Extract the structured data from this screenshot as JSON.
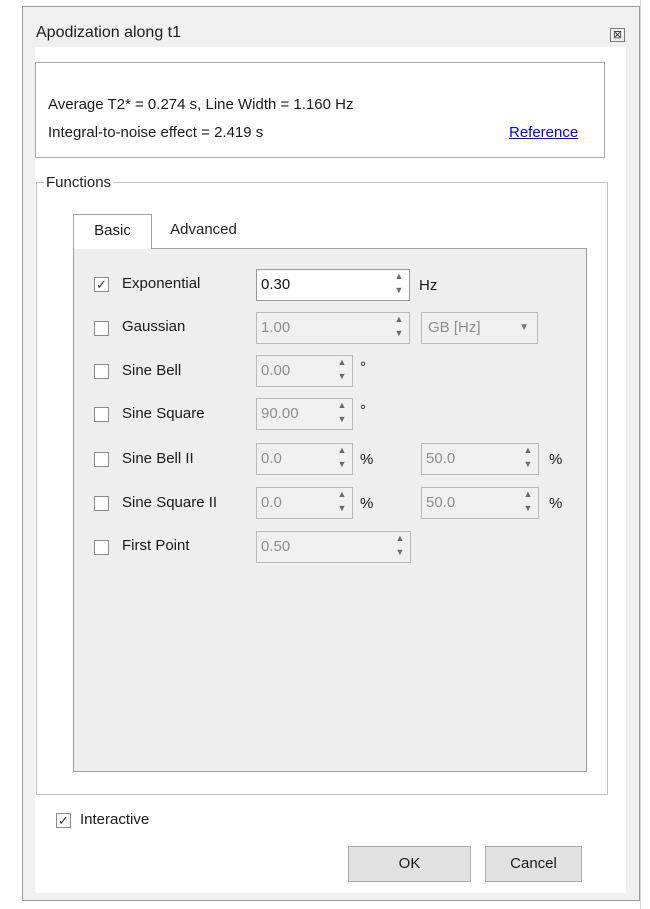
{
  "dialog": {
    "title": "Apodization along t1",
    "close_glyph": "⊠"
  },
  "info": {
    "line1": "Average T2* = 0.274 s, Line Width = 1.160 Hz",
    "line2": "Integral-to-noise effect = 2.419 s",
    "reference_link": "Reference"
  },
  "functions": {
    "group_label": "Functions",
    "tabs": [
      {
        "label": "Basic",
        "active": true
      },
      {
        "label": "Advanced",
        "active": false
      }
    ],
    "rows": [
      {
        "label": "Exponential",
        "checked": true,
        "value": "0.30",
        "unit": "Hz"
      },
      {
        "label": "Gaussian",
        "checked": false,
        "value": "1.00",
        "combo": "GB [Hz]"
      },
      {
        "label": "Sine Bell",
        "checked": false,
        "value": "0.00",
        "unit": "°"
      },
      {
        "label": "Sine Square",
        "checked": false,
        "value": "90.00",
        "unit": "°"
      },
      {
        "label": "Sine Bell II",
        "checked": false,
        "value": "0.0",
        "unit": "%",
        "value2": "50.0",
        "unit2": "%"
      },
      {
        "label": "Sine Square II",
        "checked": false,
        "value": "0.0",
        "unit": "%",
        "value2": "50.0",
        "unit2": "%"
      },
      {
        "label": "First Point",
        "checked": false,
        "value": "0.50"
      }
    ]
  },
  "footer": {
    "interactive_label": "Interactive",
    "interactive_checked": true,
    "ok_label": "OK",
    "cancel_label": "Cancel"
  },
  "icons": {
    "check": "✓",
    "spin_up": "▲",
    "spin_down": "▼",
    "dropdown": "▼"
  }
}
